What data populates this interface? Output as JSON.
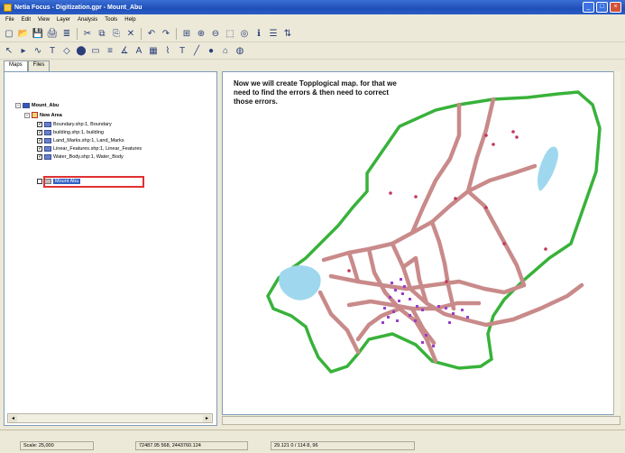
{
  "window": {
    "title": "Netia Focus - Digitization.gpr - Mount_Abu",
    "controls": [
      "_",
      "□",
      "×"
    ]
  },
  "menu": [
    "File",
    "Edit",
    "View",
    "Layer",
    "Analysis",
    "Tools",
    "Help"
  ],
  "toolbar1": [
    "▢",
    "📂",
    "💾",
    "🖨",
    "≣",
    "✂",
    "⧉",
    "⎘",
    "✕",
    "↶",
    "↷",
    "⊞",
    "⊕",
    "⊖",
    "⬚",
    "◎",
    "ℹ",
    "☰",
    "⇅"
  ],
  "toolbar2": [
    "↖",
    "▸",
    "∿",
    "T",
    "◇",
    "⬤",
    "▭",
    "≡",
    "∡",
    "A",
    "▦",
    "⌇",
    "T",
    "╱",
    "●",
    "⌂",
    "◍"
  ],
  "toc": {
    "tabs": [
      "Maps",
      "Files"
    ],
    "root": "Mount_Abu",
    "group": "New Area",
    "layers": [
      {
        "label": "Boundary.shp:1, Boundary",
        "checked": true
      },
      {
        "label": "building.shp:1, building",
        "checked": true
      },
      {
        "label": "Land_Marks.shp:1, Land_Marks",
        "checked": true
      },
      {
        "label": "Linear_Features.shp:1, Linear_Features",
        "checked": true
      },
      {
        "label": "Water_Body.shp:1, Water_Body",
        "checked": true
      }
    ],
    "selected_layer": "Mount Abu"
  },
  "map": {
    "annotation": "Now we will create Topplogical map. for that we need to find the errors & then need to correct those errors.",
    "colors": {
      "boundary": "#38b23a",
      "road": "#c98a8a",
      "water": "#9fd8ee",
      "building": "#9a3fc9",
      "landmark": "#c2365a"
    }
  },
  "status": {
    "scale": "Scale: 25,000",
    "coords": "72487.95 568, 2443760.124",
    "extra": "29.121 0 / 114 8, 96"
  }
}
